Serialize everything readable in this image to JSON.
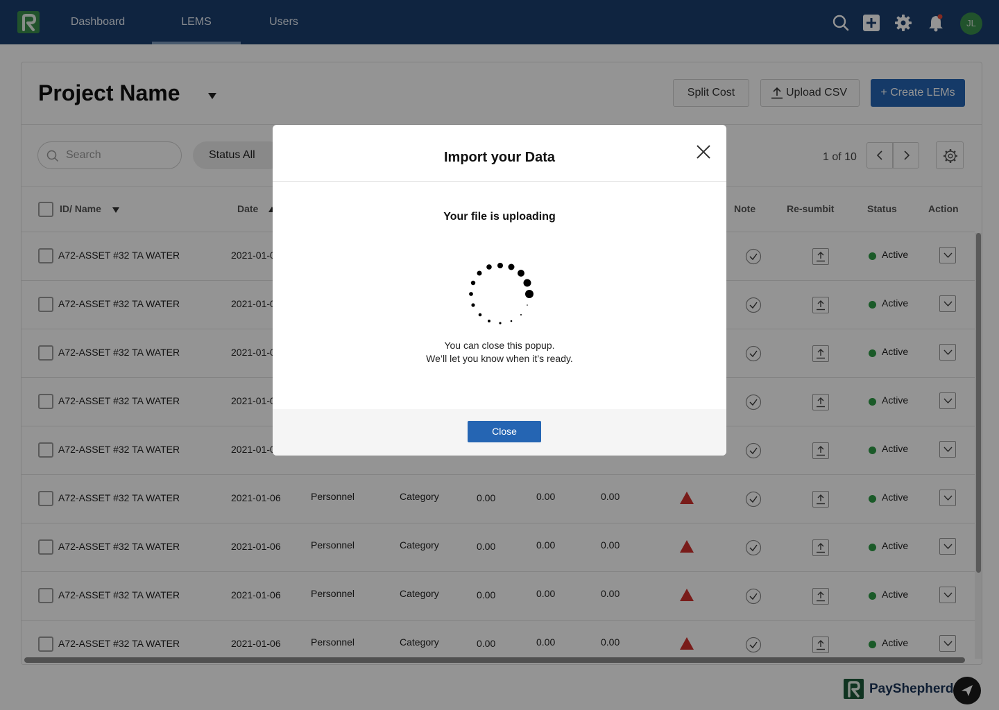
{
  "nav": {
    "items": [
      {
        "label": "Dashboard"
      },
      {
        "label": "LEMS"
      },
      {
        "label": "Users"
      }
    ],
    "avatar_initials": "JL"
  },
  "page": {
    "title": "Project Name",
    "buttons": {
      "split_cost": "Split Cost",
      "upload_csv": "Upload CSV",
      "create_lems": "+ Create LEMs"
    },
    "search_placeholder": "Search",
    "status_filter": "Status All",
    "pagination": "1 of 10"
  },
  "table": {
    "headers": {
      "id_name": "ID/ Name",
      "date": "Date",
      "note": "Note",
      "resubmit": "Re-sumbit",
      "status": "Status",
      "action": "Action"
    },
    "rows": [
      {
        "name": "A72-ASSET #32 TA WATER",
        "date": "2021-01-0",
        "type": "",
        "category": "",
        "v1": "",
        "v2": "",
        "v3": "",
        "warn": false,
        "status": "Active"
      },
      {
        "name": "A72-ASSET #32 TA WATER",
        "date": "2021-01-0",
        "type": "",
        "category": "",
        "v1": "",
        "v2": "",
        "v3": "",
        "warn": false,
        "status": "Active"
      },
      {
        "name": "A72-ASSET #32 TA WATER",
        "date": "2021-01-0",
        "type": "",
        "category": "",
        "v1": "",
        "v2": "",
        "v3": "",
        "warn": false,
        "status": "Active"
      },
      {
        "name": "A72-ASSET #32 TA WATER",
        "date": "2021-01-0",
        "type": "",
        "category": "",
        "v1": "",
        "v2": "",
        "v3": "",
        "warn": false,
        "status": "Active"
      },
      {
        "name": "A72-ASSET #32 TA WATER",
        "date": "2021-01-0",
        "type": "",
        "category": "",
        "v1": "",
        "v2": "",
        "v3": "",
        "warn": false,
        "status": "Active"
      },
      {
        "name": "A72-ASSET #32 TA WATER",
        "date": "2021-01-06",
        "type": "Personnel",
        "category": "Category",
        "v1": "0.00",
        "v2": "0.00",
        "v3": "0.00",
        "warn": true,
        "status": "Active"
      },
      {
        "name": "A72-ASSET #32 TA WATER",
        "date": "2021-01-06",
        "type": "Personnel",
        "category": "Category",
        "v1": "0.00",
        "v2": "0.00",
        "v3": "0.00",
        "warn": true,
        "status": "Active"
      },
      {
        "name": "A72-ASSET #32 TA WATER",
        "date": "2021-01-06",
        "type": "Personnel",
        "category": "Category",
        "v1": "0.00",
        "v2": "0.00",
        "v3": "0.00",
        "warn": true,
        "status": "Active"
      },
      {
        "name": "A72-ASSET #32 TA WATER",
        "date": "2021-01-06",
        "type": "Personnel",
        "category": "Category",
        "v1": "0.00",
        "v2": "0.00",
        "v3": "0.00",
        "warn": true,
        "status": "Active"
      }
    ]
  },
  "footer": {
    "brand": "PayShepherd"
  },
  "modal": {
    "title": "Import your Data",
    "heading": "Your file is uploading",
    "line1": "You can close this popup.",
    "line2": "We’ll let you know when it’s ready.",
    "close_button": "Close"
  },
  "colors": {
    "nav_bg": "#1b3f6e",
    "primary": "#2565b3",
    "status_active": "#2e9b46",
    "warning": "#d0312d"
  }
}
